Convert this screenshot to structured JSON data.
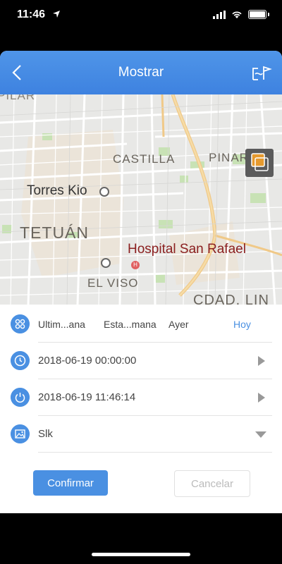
{
  "status": {
    "time": "11:46"
  },
  "nav": {
    "title": "Mostrar"
  },
  "map": {
    "labels": {
      "pilar": "PILAR",
      "castilla": "CASTILLA",
      "pinar": "PINAR DE",
      "torres": "Torres Kio",
      "tetuan": "TETUÁN",
      "hospital": "Hospital San Rafael",
      "elviso": "EL VISO",
      "cdad": "CDAD. LIN"
    }
  },
  "form": {
    "ranges": [
      "Ultim...ana",
      "Esta...mana",
      "Ayer",
      "Hoy"
    ],
    "start": "2018-06-19 00:00:00",
    "end": "2018-06-19 11:46:14",
    "map_type": "Slk"
  },
  "buttons": {
    "confirm": "Confirmar",
    "cancel": "Cancelar"
  },
  "colors": {
    "accent": "#4a90e2",
    "nav": "#4f95e8"
  }
}
